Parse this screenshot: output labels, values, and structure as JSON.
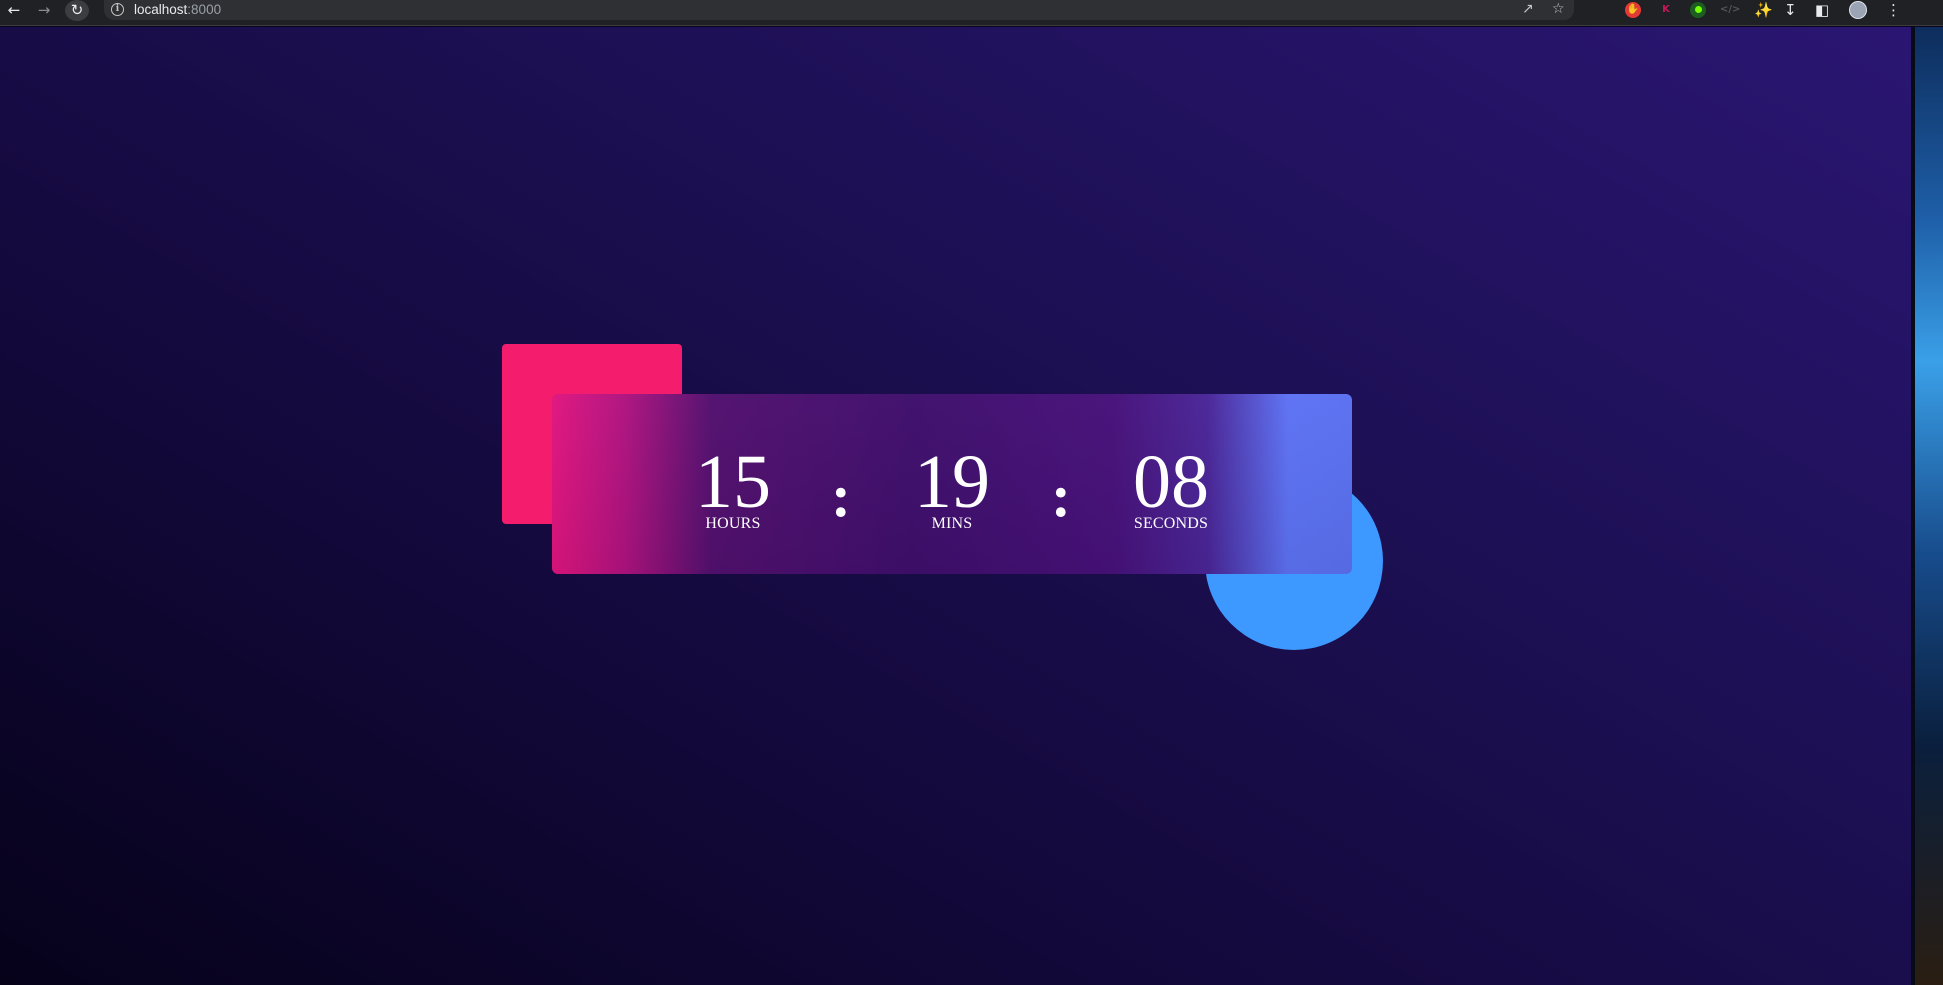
{
  "browser": {
    "url_host": "localhost",
    "url_port": ":8000"
  },
  "countdown": {
    "hours": {
      "value": "15",
      "label": "HOURS"
    },
    "mins": {
      "value": "19",
      "label": "MINS"
    },
    "seconds": {
      "value": "08",
      "label": "SECONDS"
    },
    "separator": ":"
  },
  "colors": {
    "square": "#f31c6d",
    "circle": "#3d98ff",
    "background": "#1c0f52"
  }
}
